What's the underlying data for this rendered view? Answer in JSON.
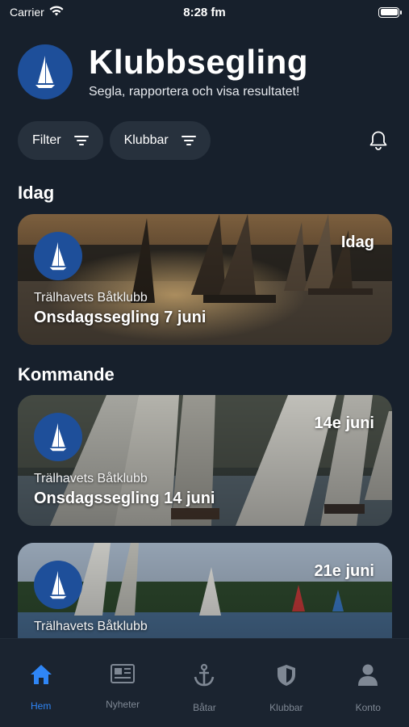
{
  "status_bar": {
    "carrier": "Carrier",
    "time": "8:28 fm"
  },
  "header": {
    "title": "Klubbsegling",
    "subtitle": "Segla, rapportera och visa resultatet!"
  },
  "filters": [
    {
      "label": "Filter"
    },
    {
      "label": "Klubbar"
    }
  ],
  "sections": {
    "today": "Idag",
    "upcoming": "Kommande"
  },
  "events": [
    {
      "date": "Idag",
      "club": "Trälhavets Båtklubb",
      "name": "Onsdagssegling 7 juni"
    },
    {
      "date": "14e juni",
      "club": "Trälhavets Båtklubb",
      "name": "Onsdagssegling 14 juni"
    },
    {
      "date": "21e juni",
      "club": "Trälhavets Båtklubb",
      "name": ""
    }
  ],
  "tabs": [
    {
      "label": "Hem",
      "icon": "home-icon",
      "active": true
    },
    {
      "label": "Nyheter",
      "icon": "newspaper-icon",
      "active": false
    },
    {
      "label": "Båtar",
      "icon": "anchor-icon",
      "active": false
    },
    {
      "label": "Klubbar",
      "icon": "shield-icon",
      "active": false
    },
    {
      "label": "Konto",
      "icon": "person-icon",
      "active": false
    }
  ],
  "colors": {
    "background": "#17202c",
    "accent": "#2f86f6",
    "logo_blue": "#1e4f9a",
    "chip": "#27313d"
  }
}
